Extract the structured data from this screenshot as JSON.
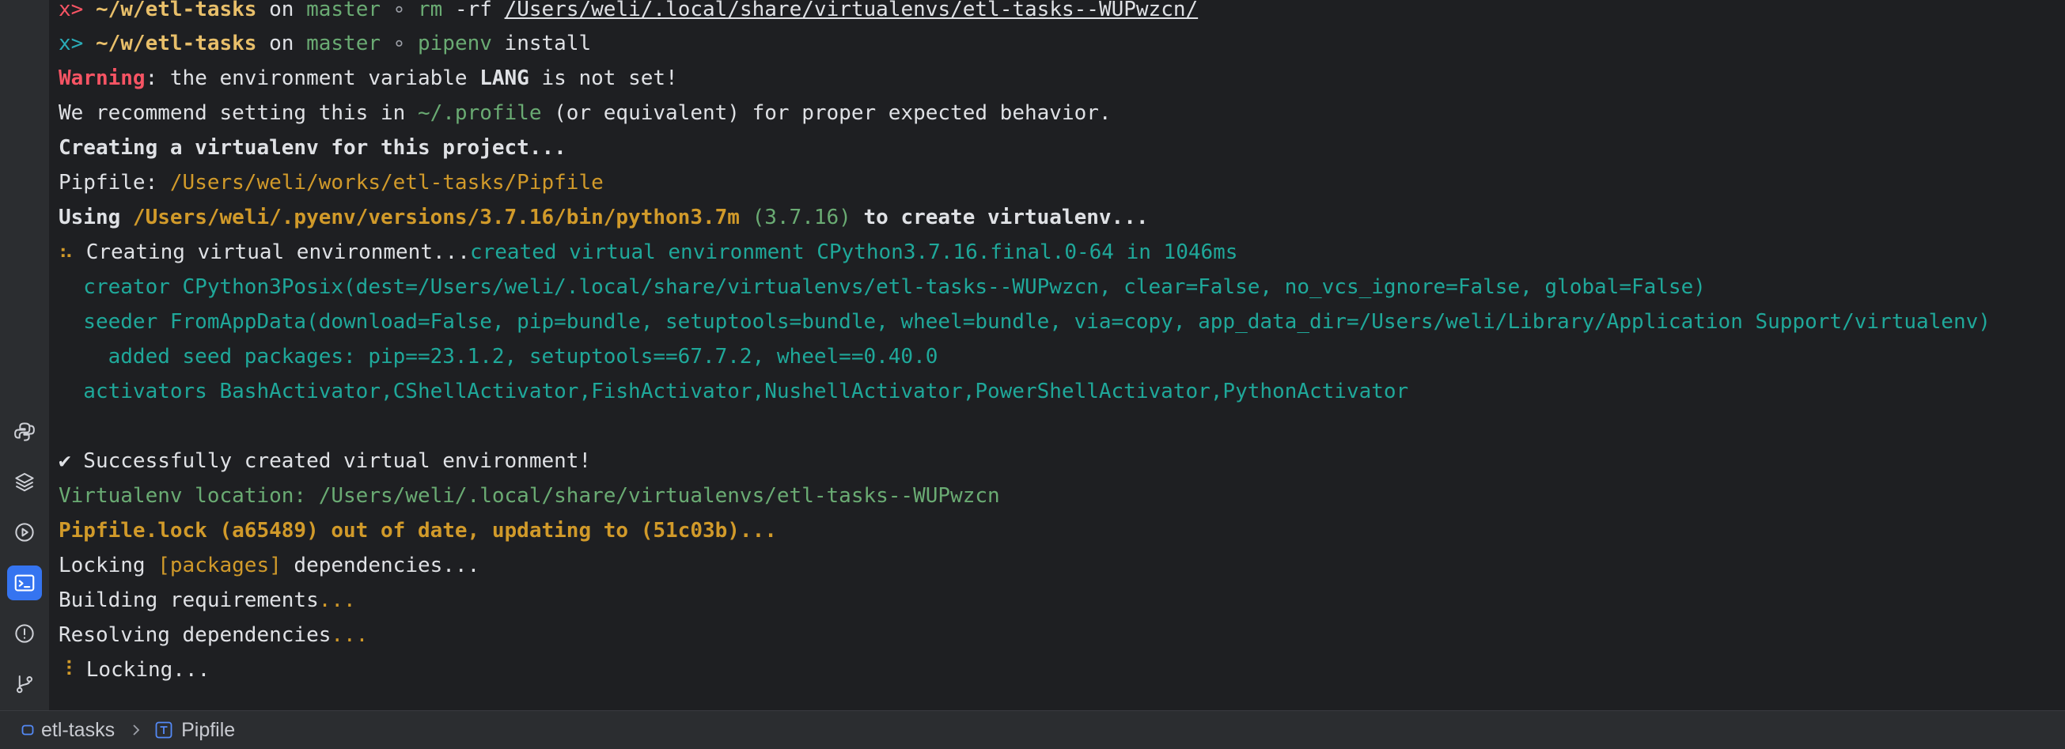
{
  "sidebar": {
    "items": [
      {
        "icon": "python-console-icon"
      },
      {
        "icon": "layers-icon"
      },
      {
        "icon": "services-icon"
      },
      {
        "icon": "terminal-icon",
        "active": true
      },
      {
        "icon": "problems-icon"
      },
      {
        "icon": "git-icon"
      }
    ]
  },
  "terminal": {
    "lines": {
      "l1": {
        "prompt": "x>",
        "dir": "~/w/etl-tasks",
        "on": " on ",
        "branch": "master",
        "sep": " ∘ ",
        "cmd": "rm",
        "args": " -rf ",
        "path": "/Users/weli/.local/share/virtualenvs/etl-tasks--WUPwzcn/"
      },
      "l2": {
        "prompt": "x>",
        "dir": "~/w/etl-tasks",
        "on": " on ",
        "branch": "master",
        "sep": " ∘ ",
        "cmd": "pipenv",
        "args": " install"
      },
      "l3": {
        "warning": "Warning",
        "rest1": ": the environment variable ",
        "var": "LANG",
        "rest2": " is not set!"
      },
      "l4": {
        "a": "We recommend setting this in ",
        "file": "~/.profile",
        "b": " (or equivalent) for proper expected behavior."
      },
      "l5": {
        "text": "Creating a virtualenv for this project..."
      },
      "l6": {
        "label": "Pipfile: ",
        "path": "/Users/weli/works/etl-tasks/Pipfile"
      },
      "l7": {
        "a": "Using ",
        "path": "/Users/weli/.pyenv/versions/3.7.16/bin/python3.7m",
        "ver": " (3.7.16)",
        "b": " to create virtualenv..."
      },
      "l8": {
        "spin": "⠦",
        "a": " Creating virtual environment...",
        "b": "created virtual environment CPython3.7.16.final.0-64 in 1046ms"
      },
      "l9": {
        "text": "  creator CPython3Posix(dest=/Users/weli/.local/share/virtualenvs/etl-tasks--WUPwzcn, clear=False, no_vcs_ignore=False, global=False)"
      },
      "l10": {
        "text": "  seeder FromAppData(download=False, pip=bundle, setuptools=bundle, wheel=bundle, via=copy, app_data_dir=/Users/weli/Library/Application Support/virtualenv)"
      },
      "l11": {
        "text": "    added seed packages: pip==23.1.2, setuptools==67.7.2, wheel==0.40.0"
      },
      "l12": {
        "text": "  activators BashActivator,CShellActivator,FishActivator,NushellActivator,PowerShellActivator,PythonActivator"
      },
      "l13": {
        "text": "✔ Successfully created virtual environment!"
      },
      "l14": {
        "text": "Virtualenv location: /Users/weli/.local/share/virtualenvs/etl-tasks--WUPwzcn"
      },
      "l15": {
        "text": "Pipfile.lock (a65489) out of date, updating to (51c03b)..."
      },
      "l16": {
        "a": "Locking ",
        "b": "[packages]",
        "c": " dependencies..."
      },
      "l17": {
        "a": "Building requirements",
        "b": "..."
      },
      "l18": {
        "a": "Resolving dependencies",
        "b": "..."
      },
      "l19": {
        "spin": "⠸",
        "a": " Locking..."
      }
    }
  },
  "statusbar": {
    "project": "etl-tasks",
    "file": "Pipfile"
  }
}
